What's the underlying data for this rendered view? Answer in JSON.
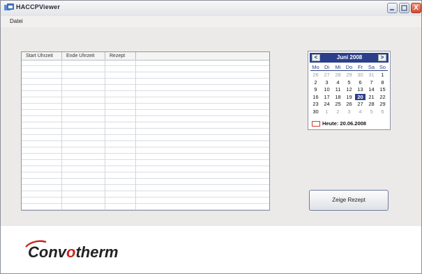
{
  "window": {
    "title": "HACCPViewer",
    "controls": [
      "minimize",
      "maximize",
      "close"
    ],
    "close_glyph": "X"
  },
  "menu": {
    "items": [
      "Datei"
    ]
  },
  "table": {
    "columns": [
      "Start Uhrzeit",
      "Ende Uhrzeit",
      "Rezept"
    ],
    "rows": []
  },
  "calendar": {
    "month_label": "Juni 2008",
    "prev_glyph": "<",
    "next_glyph": ">",
    "weekdays": [
      "Mo",
      "Di",
      "Mi",
      "Do",
      "Fr",
      "Sa",
      "So"
    ],
    "weeks": [
      [
        {
          "d": "26",
          "o": true
        },
        {
          "d": "27",
          "o": true
        },
        {
          "d": "28",
          "o": true
        },
        {
          "d": "29",
          "o": true
        },
        {
          "d": "30",
          "o": true
        },
        {
          "d": "31",
          "o": true
        },
        {
          "d": "1"
        }
      ],
      [
        {
          "d": "2"
        },
        {
          "d": "3"
        },
        {
          "d": "4"
        },
        {
          "d": "5"
        },
        {
          "d": "6"
        },
        {
          "d": "7"
        },
        {
          "d": "8"
        }
      ],
      [
        {
          "d": "9"
        },
        {
          "d": "10"
        },
        {
          "d": "11"
        },
        {
          "d": "12"
        },
        {
          "d": "13"
        },
        {
          "d": "14"
        },
        {
          "d": "15"
        }
      ],
      [
        {
          "d": "16"
        },
        {
          "d": "17"
        },
        {
          "d": "18"
        },
        {
          "d": "19"
        },
        {
          "d": "20",
          "sel": true
        },
        {
          "d": "21"
        },
        {
          "d": "22"
        }
      ],
      [
        {
          "d": "23"
        },
        {
          "d": "24"
        },
        {
          "d": "25"
        },
        {
          "d": "26"
        },
        {
          "d": "27"
        },
        {
          "d": "28"
        },
        {
          "d": "29"
        }
      ],
      [
        {
          "d": "30"
        },
        {
          "d": "1",
          "o": true
        },
        {
          "d": "2",
          "o": true
        },
        {
          "d": "3",
          "o": true
        },
        {
          "d": "4",
          "o": true
        },
        {
          "d": "5",
          "o": true
        },
        {
          "d": "6",
          "o": true
        }
      ]
    ],
    "today_label": "Heute: 20.06.2008",
    "header_color": "#2c3f8a",
    "today_marker_color": "#d23b30"
  },
  "actions": {
    "show_recipe_label": "Zeige Rezept"
  },
  "branding": {
    "logo_text_left": "Conv",
    "logo_text_o": "o",
    "logo_text_right": "therm",
    "logo_color": "#222222",
    "logo_accent": "#c8261c"
  }
}
